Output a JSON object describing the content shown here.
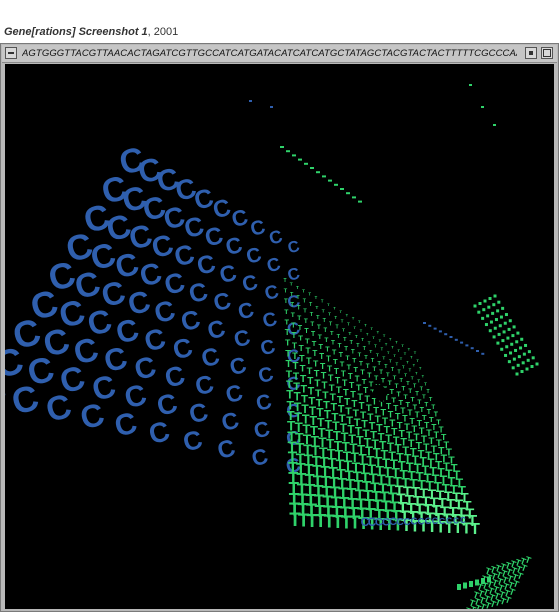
{
  "caption": {
    "title": "Gene[rations] Screenshot 1",
    "year": ", 2001"
  },
  "window": {
    "sequence": "AGTGGGTTACGTTAACACTAGATCGTTGCCATCATGATACATCATCATGCTATAGCTACGTACTACTTTTTCGCCCAACTATGCTACGTACAC"
  },
  "colors": {
    "background": "#000000",
    "blue": "#2f5fae",
    "green": "#2fd26a",
    "bright_green": "#5cf08c",
    "chrome": "#b9b9b9"
  },
  "scene": {
    "glyph_C": "C",
    "glyph_T": "T"
  }
}
